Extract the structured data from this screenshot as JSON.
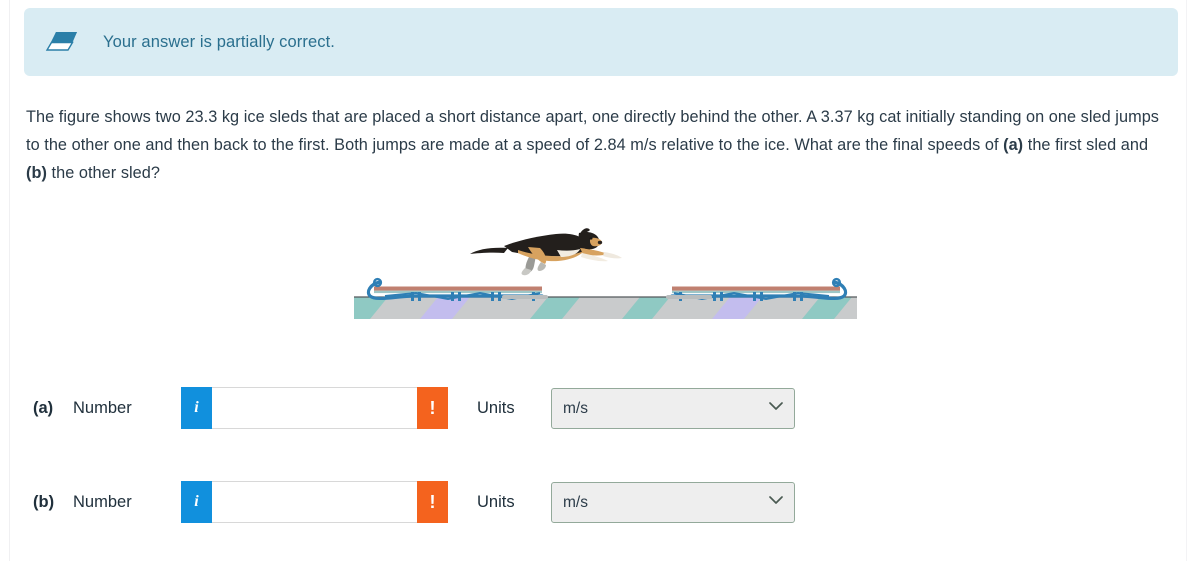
{
  "banner": {
    "icon": "eraser-parallelogram-icon",
    "message": "Your answer is partially correct.",
    "background_color": "#d9ecf3",
    "text_color": "#2a6f8e"
  },
  "problem": {
    "line1_pre": "The figure shows two 23.3 kg ice sleds that are placed a short distance apart, one directly behind the other. A 3.37 kg cat initially standing on one sled jumps to the other one and then back to the first. Both jumps are made at a speed of 2.84 m/s relative to the ice. What are the final speeds of ",
    "part_a_tag": "(a)",
    "mid": " the first sled and ",
    "part_b_tag": "(b)",
    "tail": " the other sled?",
    "values": {
      "sled_mass": "23.3 kg",
      "cat_mass": "3.37 kg",
      "jump_speed": "2.84 m/s"
    }
  },
  "figure": {
    "alt": "A cat leaping between two ice sleds resting on an ice surface",
    "sled_count": 2,
    "cat_color_body": "#211d19",
    "cat_color_tan": "#d7a25f",
    "sled_color": "#2f7fb5",
    "sled_deck_color": "#c08070",
    "ice_color": "#c9cbcc",
    "ice_accent_teal": "#8fc9c3",
    "ice_accent_lavender": "#c3bdee"
  },
  "answers": [
    {
      "part": "(a)",
      "number_label": "Number",
      "info_icon": "info-icon",
      "info_glyph": "i",
      "value": "",
      "placeholder": "",
      "alert_icon": "exclamation-icon",
      "alert_glyph": "!",
      "units_label": "Units",
      "units_value": "m/s",
      "units_options": [
        "m/s"
      ]
    },
    {
      "part": "(b)",
      "number_label": "Number",
      "info_icon": "info-icon",
      "info_glyph": "i",
      "value": "",
      "placeholder": "",
      "alert_icon": "exclamation-icon",
      "alert_glyph": "!",
      "units_label": "Units",
      "units_value": "m/s",
      "units_options": [
        "m/s"
      ]
    }
  ],
  "colors": {
    "info_blue": "#1190dd",
    "alert_orange": "#f4631e",
    "select_border": "#93a99a",
    "select_bg": "#eeeeee"
  }
}
